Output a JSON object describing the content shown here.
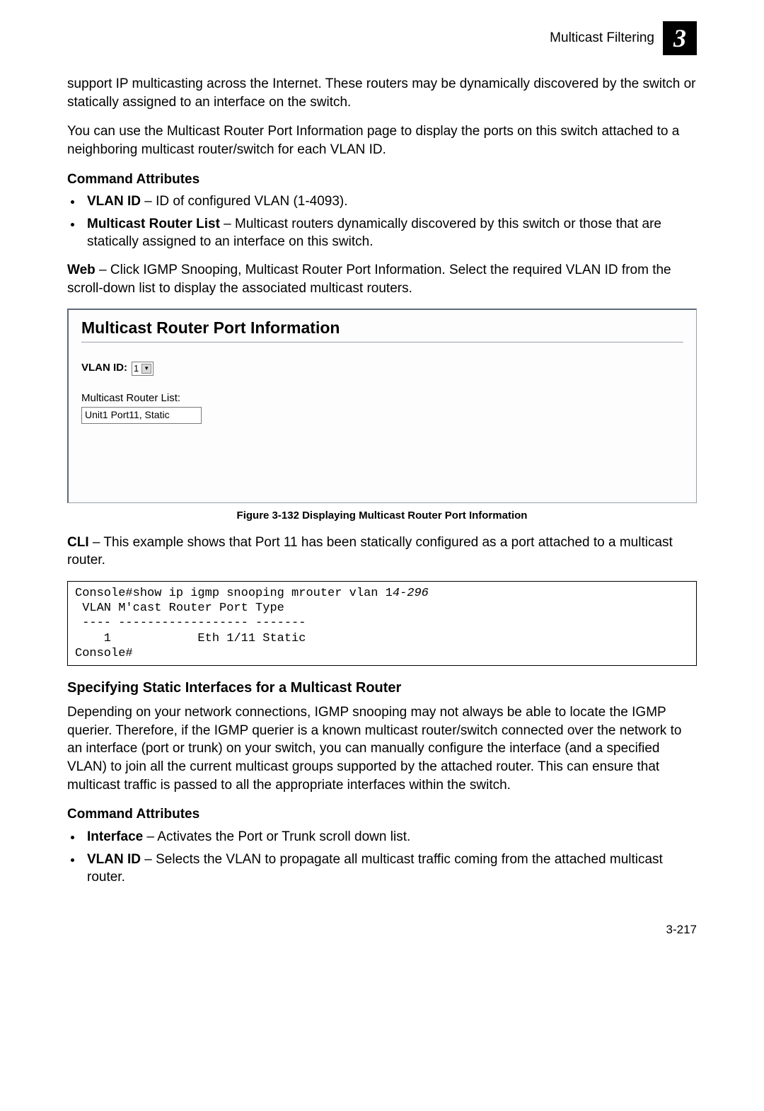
{
  "header": {
    "section": "Multicast Filtering",
    "chapter_number": "3"
  },
  "intro_p1": "support IP multicasting across the Internet. These routers may be dynamically discovered by the switch or statically assigned to an interface on the switch.",
  "intro_p2": "You can use the Multicast Router Port Information page to display the ports on this switch attached to a neighboring multicast router/switch for each VLAN ID.",
  "cmd_attr_heading": "Command Attributes",
  "attr1_bold": "VLAN ID",
  "attr1_rest": " – ID of configured VLAN (1-4093).",
  "attr2_bold": "Multicast Router List",
  "attr2_rest": " – Multicast routers dynamically discovered by this switch or those that are statically assigned to an interface on this switch.",
  "web_bold": "Web",
  "web_rest": " – Click IGMP Snooping, Multicast Router Port Information. Select the required VLAN ID from the scroll-down list to display the associated multicast routers.",
  "screenshot": {
    "title": "Multicast Router Port Information",
    "vlan_label": "VLAN ID:",
    "vlan_value": "1",
    "list_label": "Multicast Router List:",
    "list_value": "Unit1 Port11, Static"
  },
  "figure_caption": "Figure 3-132  Displaying Multicast Router Port Information",
  "cli_bold": "CLI",
  "cli_rest": " – This example shows that Port 11 has been statically configured as a port attached to a multicast router.",
  "cli_output_pre": "Console#show ip igmp snooping mrouter vlan 1",
  "cli_output_ref": "4-296",
  "cli_output_post": " VLAN M'cast Router Port Type\n ---- ------------------ -------\n    1            Eth 1/11 Static\nConsole#",
  "section2_heading": "Specifying Static Interfaces for a Multicast Router",
  "section2_p1": "Depending on your network connections, IGMP snooping may not always be able to locate the IGMP querier. Therefore, if the IGMP querier is a known multicast router/switch connected over the network to an interface (port or trunk) on your switch, you can manually configure the interface (and a specified VLAN) to join all the current multicast groups supported by the attached router. This can ensure that multicast traffic is passed to all the appropriate interfaces within the switch.",
  "cmd_attr_heading2": "Command Attributes",
  "s2_attr1_bold": "Interface",
  "s2_attr1_rest": " – Activates the Port or Trunk scroll down list.",
  "s2_attr2_bold": "VLAN ID",
  "s2_attr2_rest": " – Selects the VLAN to propagate all multicast traffic coming from the attached multicast router.",
  "page_number": "3-217"
}
